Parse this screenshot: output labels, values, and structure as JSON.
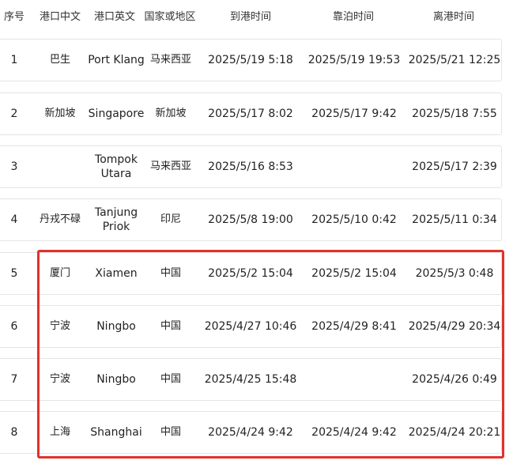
{
  "columns": {
    "seq": "序号",
    "port_cn": "港口中文",
    "port_en": "港口英文",
    "country": "国家或地区",
    "arrival": "到港时间",
    "berthing": "靠泊时间",
    "departure": "离港时间"
  },
  "rows": [
    {
      "seq": "1",
      "port_cn": "巴生",
      "port_en": "Port Klang",
      "country": "马来西亚",
      "arrival": "2025/5/19 5:18",
      "berthing": "2025/5/19 19:53",
      "departure": "2025/5/21 12:25"
    },
    {
      "seq": "2",
      "port_cn": "新加坡",
      "port_en": "Singapore",
      "country": "新加坡",
      "arrival": "2025/5/17 8:02",
      "berthing": "2025/5/17 9:42",
      "departure": "2025/5/18 7:55"
    },
    {
      "seq": "3",
      "port_cn": "",
      "port_en": "Tompok Utara",
      "country": "马来西亚",
      "arrival": "2025/5/16 8:53",
      "berthing": "",
      "departure": "2025/5/17 2:39"
    },
    {
      "seq": "4",
      "port_cn": "丹戎不碌",
      "port_en": "Tanjung Priok",
      "country": "印尼",
      "arrival": "2025/5/8 19:00",
      "berthing": "2025/5/10 0:42",
      "departure": "2025/5/11 0:34"
    },
    {
      "seq": "5",
      "port_cn": "厦门",
      "port_en": "Xiamen",
      "country": "中国",
      "arrival": "2025/5/2 15:04",
      "berthing": "2025/5/2 15:04",
      "departure": "2025/5/3 0:48"
    },
    {
      "seq": "6",
      "port_cn": "宁波",
      "port_en": "Ningbo",
      "country": "中国",
      "arrival": "2025/4/27 10:46",
      "berthing": "2025/4/29 8:41",
      "departure": "2025/4/29 20:34"
    },
    {
      "seq": "7",
      "port_cn": "宁波",
      "port_en": "Ningbo",
      "country": "中国",
      "arrival": "2025/4/25 15:48",
      "berthing": "",
      "departure": "2025/4/26 0:49"
    },
    {
      "seq": "8",
      "port_cn": "上海",
      "port_en": "Shanghai",
      "country": "中国",
      "arrival": "2025/4/24 9:42",
      "berthing": "2025/4/24 9:42",
      "departure": "2025/4/24 20:21"
    }
  ],
  "highlight": {
    "color": "#e0322c"
  }
}
